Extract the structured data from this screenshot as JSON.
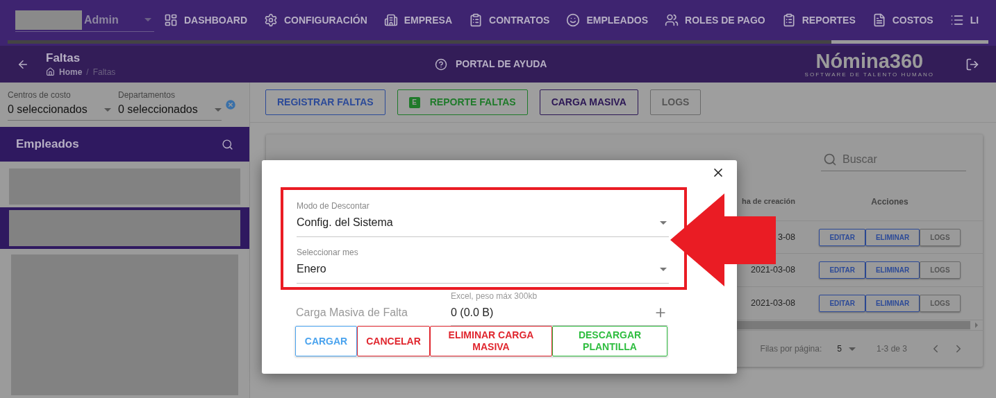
{
  "top_nav": {
    "user_role": "Admin",
    "items": [
      {
        "label": "DASHBOARD"
      },
      {
        "label": "CONFIGURACIÓN"
      },
      {
        "label": "EMPRESA"
      },
      {
        "label": "CONTRATOS"
      },
      {
        "label": "EMPLEADOS"
      },
      {
        "label": "ROLES DE PAGO"
      },
      {
        "label": "REPORTES"
      },
      {
        "label": "COSTOS"
      },
      {
        "label": "LI"
      }
    ],
    "loading_bar": {
      "level": 0.84
    }
  },
  "page_header": {
    "title": "Faltas",
    "breadcrumb": [
      "Home",
      "Faltas"
    ],
    "breadcrumb_separator": "/",
    "help_link": "PORTAL DE AYUDA",
    "logo": {
      "name": "Nómina360",
      "tagline": "SOFTWARE DE TALENTO HUMANO"
    }
  },
  "filters": [
    {
      "label": "Centros de costo",
      "value": "0 seleccionados"
    },
    {
      "label": "Departamentos",
      "value": "0 seleccionados"
    }
  ],
  "employees_panel": {
    "title": "Empleados",
    "items": [
      {
        "selected": false
      },
      {
        "selected": true
      },
      {
        "selected": false
      }
    ]
  },
  "toolbar": [
    {
      "label": "REGISTRAR FALTAS",
      "kind": "primary"
    },
    {
      "label": "REPORTE FALTAS",
      "kind": "excel",
      "badge": "E"
    },
    {
      "label": "CARGA MASIVA",
      "kind": "secondary"
    },
    {
      "label": "LOGS",
      "kind": "neutral"
    }
  ],
  "table": {
    "search_placeholder": "Buscar",
    "columns": [
      "ha de creación",
      "Acciones"
    ],
    "rows": [
      {
        "date": "3-08",
        "actions": [
          {
            "label": "EDITAR",
            "kind": "primary"
          },
          {
            "label": "ELIMINAR",
            "kind": "primary"
          },
          {
            "label": "LOGS",
            "kind": "neutral"
          }
        ]
      },
      {
        "date": "2021-03-08",
        "actions": [
          {
            "label": "EDITAR",
            "kind": "primary"
          },
          {
            "label": "ELIMINAR",
            "kind": "primary"
          },
          {
            "label": "LOGS",
            "kind": "neutral"
          }
        ]
      },
      {
        "date": "2021-03-08",
        "actions": [
          {
            "label": "EDITAR",
            "kind": "primary"
          },
          {
            "label": "ELIMINAR",
            "kind": "primary"
          },
          {
            "label": "LOGS",
            "kind": "neutral"
          }
        ]
      }
    ],
    "footer": {
      "rows_per_page_label": "Filas por página:",
      "rows_per_page": "5",
      "range": "1-3 de 3"
    }
  },
  "modal": {
    "fields": [
      {
        "label": "Modo de Descontar",
        "value": "Config. del Sistema"
      },
      {
        "label": "Seleccionar mes",
        "value": "Enero"
      }
    ],
    "upload": {
      "label": "Carga Masiva de Falta",
      "hint": "Excel, peso máx 300kb",
      "value": "0 (0.0 B)"
    },
    "buttons": [
      {
        "label": "CARGAR",
        "kind": "info"
      },
      {
        "label": "CANCELAR",
        "kind": "danger"
      },
      {
        "label": "ELIMINAR CARGA MASIVA",
        "kind": "danger"
      },
      {
        "label": "DESCARGAR PLANTILLA",
        "kind": "success"
      }
    ]
  }
}
